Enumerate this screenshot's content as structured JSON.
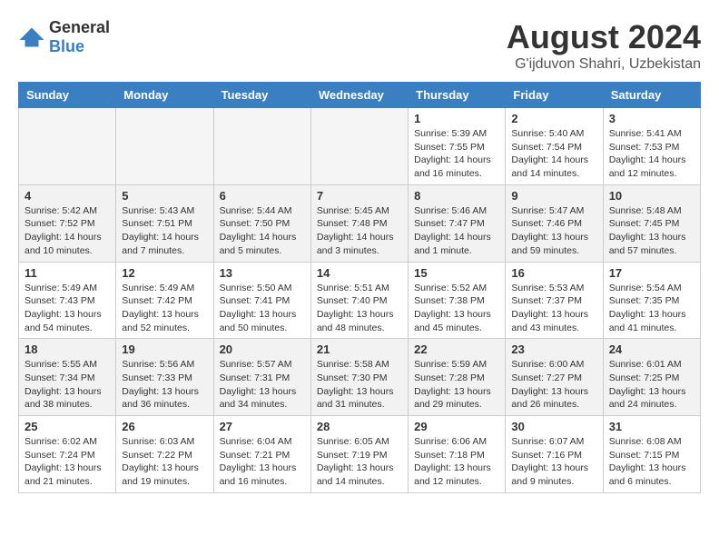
{
  "logo": {
    "general": "General",
    "blue": "Blue"
  },
  "title": "August 2024",
  "subtitle": "G'ijduvon Shahri, Uzbekistan",
  "headers": [
    "Sunday",
    "Monday",
    "Tuesday",
    "Wednesday",
    "Thursday",
    "Friday",
    "Saturday"
  ],
  "weeks": [
    [
      {
        "day": "",
        "info": ""
      },
      {
        "day": "",
        "info": ""
      },
      {
        "day": "",
        "info": ""
      },
      {
        "day": "",
        "info": ""
      },
      {
        "day": "1",
        "info": "Sunrise: 5:39 AM\nSunset: 7:55 PM\nDaylight: 14 hours\nand 16 minutes."
      },
      {
        "day": "2",
        "info": "Sunrise: 5:40 AM\nSunset: 7:54 PM\nDaylight: 14 hours\nand 14 minutes."
      },
      {
        "day": "3",
        "info": "Sunrise: 5:41 AM\nSunset: 7:53 PM\nDaylight: 14 hours\nand 12 minutes."
      }
    ],
    [
      {
        "day": "4",
        "info": "Sunrise: 5:42 AM\nSunset: 7:52 PM\nDaylight: 14 hours\nand 10 minutes."
      },
      {
        "day": "5",
        "info": "Sunrise: 5:43 AM\nSunset: 7:51 PM\nDaylight: 14 hours\nand 7 minutes."
      },
      {
        "day": "6",
        "info": "Sunrise: 5:44 AM\nSunset: 7:50 PM\nDaylight: 14 hours\nand 5 minutes."
      },
      {
        "day": "7",
        "info": "Sunrise: 5:45 AM\nSunset: 7:48 PM\nDaylight: 14 hours\nand 3 minutes."
      },
      {
        "day": "8",
        "info": "Sunrise: 5:46 AM\nSunset: 7:47 PM\nDaylight: 14 hours\nand 1 minute."
      },
      {
        "day": "9",
        "info": "Sunrise: 5:47 AM\nSunset: 7:46 PM\nDaylight: 13 hours\nand 59 minutes."
      },
      {
        "day": "10",
        "info": "Sunrise: 5:48 AM\nSunset: 7:45 PM\nDaylight: 13 hours\nand 57 minutes."
      }
    ],
    [
      {
        "day": "11",
        "info": "Sunrise: 5:49 AM\nSunset: 7:43 PM\nDaylight: 13 hours\nand 54 minutes."
      },
      {
        "day": "12",
        "info": "Sunrise: 5:49 AM\nSunset: 7:42 PM\nDaylight: 13 hours\nand 52 minutes."
      },
      {
        "day": "13",
        "info": "Sunrise: 5:50 AM\nSunset: 7:41 PM\nDaylight: 13 hours\nand 50 minutes."
      },
      {
        "day": "14",
        "info": "Sunrise: 5:51 AM\nSunset: 7:40 PM\nDaylight: 13 hours\nand 48 minutes."
      },
      {
        "day": "15",
        "info": "Sunrise: 5:52 AM\nSunset: 7:38 PM\nDaylight: 13 hours\nand 45 minutes."
      },
      {
        "day": "16",
        "info": "Sunrise: 5:53 AM\nSunset: 7:37 PM\nDaylight: 13 hours\nand 43 minutes."
      },
      {
        "day": "17",
        "info": "Sunrise: 5:54 AM\nSunset: 7:35 PM\nDaylight: 13 hours\nand 41 minutes."
      }
    ],
    [
      {
        "day": "18",
        "info": "Sunrise: 5:55 AM\nSunset: 7:34 PM\nDaylight: 13 hours\nand 38 minutes."
      },
      {
        "day": "19",
        "info": "Sunrise: 5:56 AM\nSunset: 7:33 PM\nDaylight: 13 hours\nand 36 minutes."
      },
      {
        "day": "20",
        "info": "Sunrise: 5:57 AM\nSunset: 7:31 PM\nDaylight: 13 hours\nand 34 minutes."
      },
      {
        "day": "21",
        "info": "Sunrise: 5:58 AM\nSunset: 7:30 PM\nDaylight: 13 hours\nand 31 minutes."
      },
      {
        "day": "22",
        "info": "Sunrise: 5:59 AM\nSunset: 7:28 PM\nDaylight: 13 hours\nand 29 minutes."
      },
      {
        "day": "23",
        "info": "Sunrise: 6:00 AM\nSunset: 7:27 PM\nDaylight: 13 hours\nand 26 minutes."
      },
      {
        "day": "24",
        "info": "Sunrise: 6:01 AM\nSunset: 7:25 PM\nDaylight: 13 hours\nand 24 minutes."
      }
    ],
    [
      {
        "day": "25",
        "info": "Sunrise: 6:02 AM\nSunset: 7:24 PM\nDaylight: 13 hours\nand 21 minutes."
      },
      {
        "day": "26",
        "info": "Sunrise: 6:03 AM\nSunset: 7:22 PM\nDaylight: 13 hours\nand 19 minutes."
      },
      {
        "day": "27",
        "info": "Sunrise: 6:04 AM\nSunset: 7:21 PM\nDaylight: 13 hours\nand 16 minutes."
      },
      {
        "day": "28",
        "info": "Sunrise: 6:05 AM\nSunset: 7:19 PM\nDaylight: 13 hours\nand 14 minutes."
      },
      {
        "day": "29",
        "info": "Sunrise: 6:06 AM\nSunset: 7:18 PM\nDaylight: 13 hours\nand 12 minutes."
      },
      {
        "day": "30",
        "info": "Sunrise: 6:07 AM\nSunset: 7:16 PM\nDaylight: 13 hours\nand 9 minutes."
      },
      {
        "day": "31",
        "info": "Sunrise: 6:08 AM\nSunset: 7:15 PM\nDaylight: 13 hours\nand 6 minutes."
      }
    ]
  ]
}
